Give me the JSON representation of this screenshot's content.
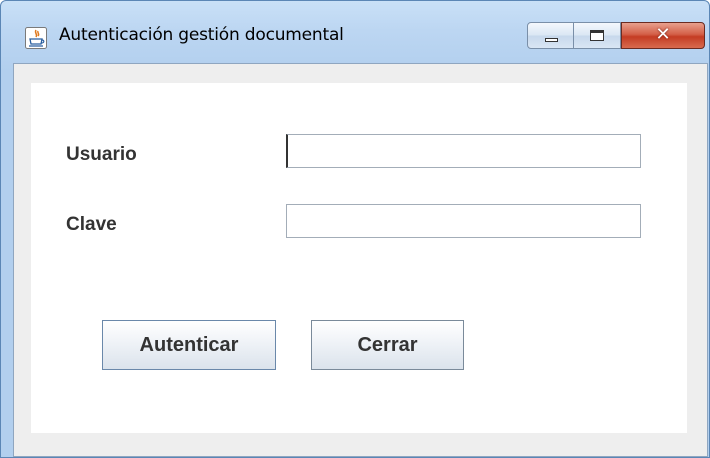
{
  "window": {
    "title": "Autenticación gestión documental",
    "app_icon": "java-icon",
    "controls": {
      "minimize_icon": "minimize-icon",
      "maximize_icon": "maximize-icon",
      "close_icon": "close-icon",
      "close_glyph": "✕"
    }
  },
  "form": {
    "user_label": "Usuario",
    "user_value": "",
    "password_label": "Clave",
    "password_value": ""
  },
  "buttons": {
    "authenticate_label": "Autenticar",
    "close_label": "Cerrar"
  },
  "colors": {
    "title_bar": "#bcd6f2",
    "close_button": "#c43c23",
    "panel_background": "#eeeeee"
  }
}
